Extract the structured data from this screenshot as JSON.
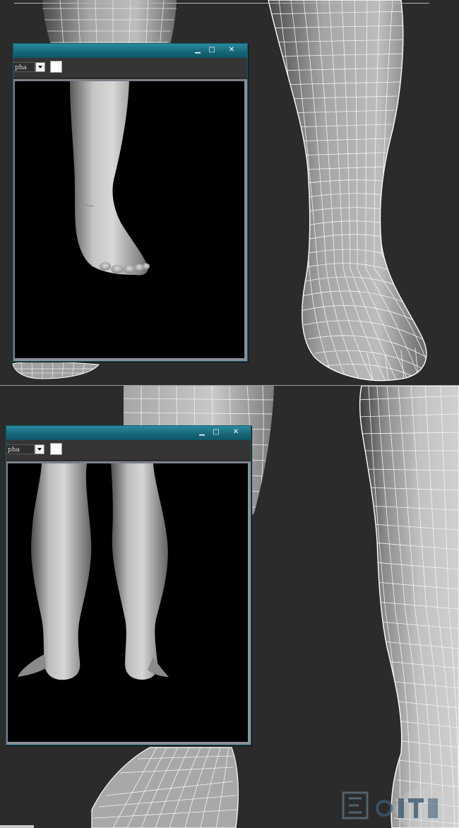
{
  "top_panel": {
    "render_window": {
      "channel_value": "pha",
      "buttons": {
        "minimize_glyph": "▁",
        "maximize_glyph": "□",
        "close_glyph": "✕"
      },
      "swatch_color": "#ffffff"
    }
  },
  "bottom_panel": {
    "render_window": {
      "channel_value": "pha",
      "buttons": {
        "minimize_glyph": "▁",
        "maximize_glyph": "□",
        "close_glyph": "✕"
      },
      "swatch_color": "#ffffff"
    }
  },
  "colors": {
    "workspace_bg": "#2b2b2b",
    "title_bar": "#17677a",
    "wire": "#f2f2f2",
    "mesh_fill": "#9a9a9a",
    "render_bg": "#000000"
  },
  "icons": {
    "window_minimize": "minimize-icon",
    "window_maximize": "maximize-icon",
    "window_close": "close-icon",
    "dropdown": "chevron-down-icon",
    "watermark": "logo-icon"
  }
}
